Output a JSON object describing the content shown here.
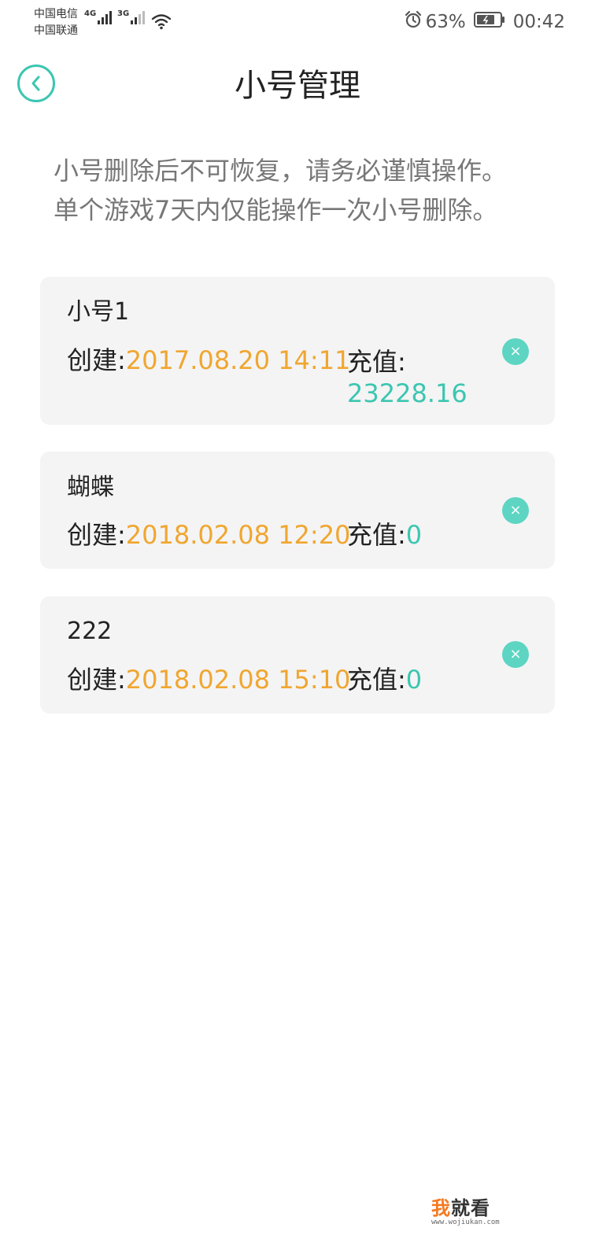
{
  "status_bar": {
    "carrier_1": "中国电信",
    "carrier_2": "中国联通",
    "network_1": "4G",
    "network_2": "3G",
    "battery": "63%",
    "time": "00:42"
  },
  "header": {
    "title": "小号管理"
  },
  "notice": {
    "line_1": "小号删除后不可恢复，请务必谨慎操作。",
    "line_2": "单个游戏7天内仅能操作一次小号删除。"
  },
  "accounts": [
    {
      "name": "小号1",
      "created_label": "创建:",
      "created_value": "2017.08.20 14:11",
      "recharge_label": "充值:",
      "recharge_value": "23228.16"
    },
    {
      "name": "蝴蝶",
      "created_label": "创建:",
      "created_value": "2018.02.08 12:20",
      "recharge_label": "充值:",
      "recharge_value": "0"
    },
    {
      "name": "222",
      "created_label": "创建:",
      "created_value": "2018.02.08 15:10",
      "recharge_label": "充值:",
      "recharge_value": "0"
    }
  ],
  "delete_symbol": "×",
  "watermark": {
    "text_accent": "我",
    "text_rest": "就看",
    "url": "www.wojiukan.com"
  },
  "colors": {
    "accent_teal": "#3cc6b1",
    "date_orange": "#f0a630",
    "card_bg": "#f4f4f4"
  }
}
